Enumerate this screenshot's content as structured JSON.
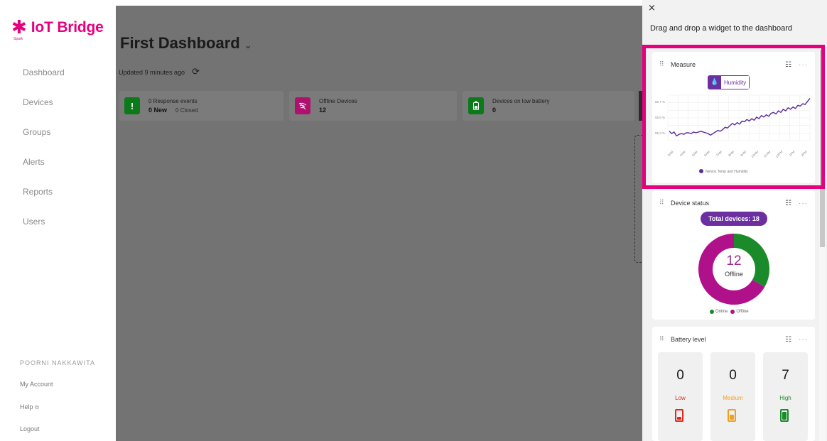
{
  "app": {
    "logo_icon": "asterisk-logo-icon",
    "logo_text": "IoT Bridge",
    "logo_sub": "Spark",
    "brand_color": "#e6007e"
  },
  "sidebar": {
    "items": [
      {
        "label": "Dashboard",
        "active": true
      },
      {
        "label": "Devices",
        "active": false
      },
      {
        "label": "Groups",
        "active": false
      },
      {
        "label": "Alerts",
        "active": false
      },
      {
        "label": "Reports",
        "active": false
      },
      {
        "label": "Users",
        "active": false
      }
    ],
    "user_name": "POORNI NAKKAWITA",
    "footer": {
      "my_account": "My Account",
      "help": "Help",
      "logout": "Logout"
    }
  },
  "main": {
    "title": "First Dashboard",
    "updated": "Updated 9 minutes ago",
    "tiles": [
      {
        "icon": "exclamation-icon",
        "title": "0 Response events",
        "value": "0 New",
        "sub": "0 Closed",
        "color": "#0a7a1a"
      },
      {
        "icon": "offline-signal-icon",
        "title": "Offline Devices",
        "value": "12",
        "sub": "",
        "color": "#b0106e"
      },
      {
        "icon": "battery-icon",
        "title": "Devices on low battery",
        "value": "0",
        "sub": "",
        "color": "#0a7a1a"
      }
    ]
  },
  "panel": {
    "close": "×",
    "title": "Drag and drop a widget to the dashboard",
    "measure": {
      "name": "Measure",
      "chip": "Humidity",
      "chip_icon": "droplet-icon"
    },
    "device_status": {
      "name": "Device status",
      "total": "Total devices: 18",
      "center_value": "12",
      "center_label": "Offline",
      "legend": [
        {
          "label": "Online",
          "color": "#1a8a2a"
        },
        {
          "label": "Offline",
          "color": "#b0108a"
        }
      ],
      "online": 6,
      "offline": 12
    },
    "battery": {
      "name": "Battery level",
      "levels": [
        {
          "count": "0",
          "label": "Low",
          "color": "#e0281e",
          "fill": 0.2
        },
        {
          "count": "0",
          "label": "Medium",
          "color": "#f0a020",
          "fill": 0.5
        },
        {
          "count": "7",
          "label": "High",
          "color": "#1a8a2a",
          "fill": 0.85
        }
      ]
    }
  },
  "chart_data": {
    "type": "line",
    "y_ticks": [
      "55.7 %",
      "55.5 %",
      "55.3 %"
    ],
    "x_ticks": [
      "3AM",
      "4AM",
      "5AM",
      "6AM",
      "7AM",
      "8AM",
      "9AM",
      "10AM",
      "11AM",
      "12PM",
      "1PM",
      "2PM"
    ],
    "ylim": [
      55.2,
      55.78
    ],
    "series": [
      {
        "name": "Netvox Temp and Humidity",
        "color": "#5a2d9c",
        "values": [
          55.32,
          55.29,
          55.31,
          55.26,
          55.28,
          55.29,
          55.28,
          55.3,
          55.3,
          55.29,
          55.31,
          55.3,
          55.31,
          55.32,
          55.31,
          55.3,
          55.29,
          55.27,
          55.29,
          55.31,
          55.33,
          55.32,
          55.34,
          55.37,
          55.36,
          55.39,
          55.42,
          55.4,
          55.43,
          55.41,
          55.45,
          55.44,
          55.47,
          55.45,
          55.48,
          55.46,
          55.5,
          55.48,
          55.52,
          55.5,
          55.53,
          55.51,
          55.55,
          55.56,
          55.54,
          55.58,
          55.56,
          55.6,
          55.58,
          55.62,
          55.6,
          55.63,
          55.61,
          55.65,
          55.64,
          55.67,
          55.66,
          55.7,
          55.74
        ]
      }
    ],
    "legend": "bottom"
  }
}
